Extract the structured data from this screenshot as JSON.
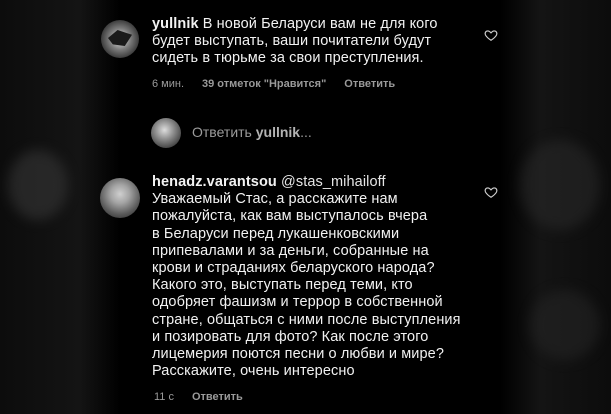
{
  "comment1": {
    "username": "yullnik",
    "text": "В новой Беларуси вам не для кого\nбудет выступать, ваши почитатели будут\nсидеть в тюрьме за свои преступления.",
    "time": "6 мин.",
    "likes": "39 отметок \"Нравится\"",
    "reply_label": "Ответить"
  },
  "reply_prompt": {
    "prefix": "Ответить ",
    "username": "yullnik",
    "suffix": "..."
  },
  "comment2": {
    "username": "henadz.varantsou",
    "mention": "@stas_mihailoff",
    "text": "Уважаемый Стас, а расскажите нам\nпожалуйста, как вам выступалось вчера\nв Беларуси перед лукашенковскими\nприпевалами и за деньги, собранные на\nкрови и страданиях беларуского народа?\nКакого это, выступать перед теми, кто\nодобряет фашизм и террор в собственной\nстране, общаться с ними после выступления\nи позировать для фото? Как после этого\nлицемерия поются песни о любви и мире?\nРасскажите, очень интересно",
    "time": "11 с",
    "reply_label": "Ответить"
  },
  "icons": {
    "heart": "heart-icon"
  }
}
